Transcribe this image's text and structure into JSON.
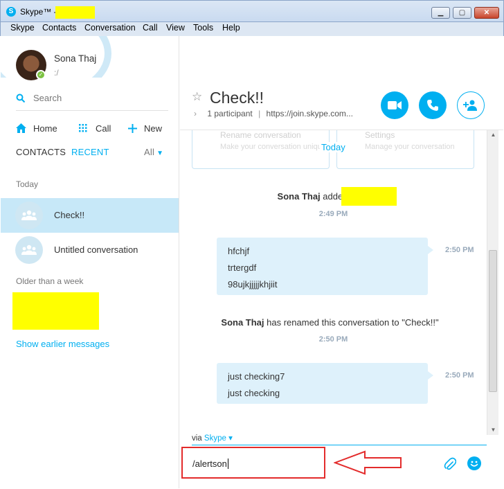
{
  "window": {
    "title": "Skype™ -",
    "controls": {
      "minimize": "▁",
      "maximize": "▢",
      "close": "✕"
    }
  },
  "menu": [
    "Skype",
    "Contacts",
    "Conversation",
    "Call",
    "View",
    "Tools",
    "Help"
  ],
  "profile": {
    "name": "Sona Thaj",
    "mood": ":/"
  },
  "search": {
    "placeholder": "Search"
  },
  "nav": {
    "home": "Home",
    "call": "Call",
    "new": "New"
  },
  "tabs": {
    "contacts": "CONTACTS",
    "recent": "RECENT",
    "filter": "All"
  },
  "sections": {
    "today": "Today",
    "older": "Older than a week"
  },
  "conversations": [
    {
      "name": "Check!!",
      "active": true
    },
    {
      "name": "Untitled conversation",
      "active": false
    }
  ],
  "show_earlier": "Show earlier messages",
  "header": {
    "title": "Check!!",
    "participants": "1 participant",
    "sep": "|",
    "link": "https://join.skype.com..."
  },
  "chat": {
    "faded_cards": [
      {
        "title": "Rename conversation",
        "subtitle": "Make your conversation unique"
      },
      {
        "title": "Settings",
        "subtitle": "Manage your conversation"
      }
    ],
    "date_divider": "Today",
    "event_added": {
      "who": "Sona Thaj",
      "action": "added",
      "time": "2:49 PM"
    },
    "message1": {
      "lines": [
        "hfchjf",
        "trtergdf",
        "98ujkjjjjjkhjiit"
      ],
      "time": "2:50 PM"
    },
    "event_renamed": {
      "who": "Sona Thaj",
      "action": "has renamed this conversation to \"Check!!\"",
      "time": "2:50 PM"
    },
    "message2": {
      "lines": [
        "just checking7",
        "just checking"
      ],
      "time": "2:50 PM"
    }
  },
  "compose": {
    "via": "via",
    "service": "Skype",
    "value": "/alertson"
  },
  "colors": {
    "accent": "#00aff0",
    "bubble": "#def1fb",
    "active_row": "#c7e8f8",
    "annotation_red": "#e32b2b",
    "redaction": "#ffff00"
  }
}
